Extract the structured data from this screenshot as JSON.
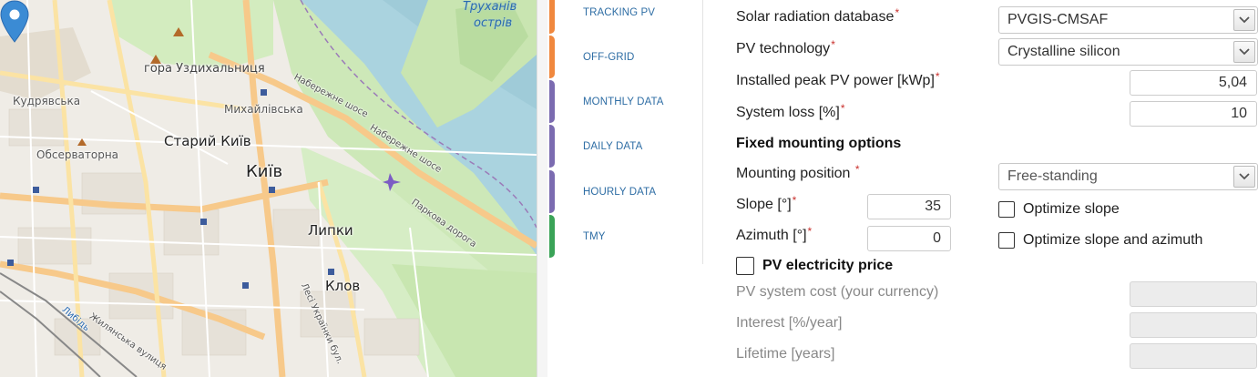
{
  "map": {
    "labels": {
      "trukhaniv": "Труханів",
      "ostriv": "острів",
      "hora": "гора Уздихальниця",
      "kudriavska": "Кудрявська",
      "mykhailivska": "Михайлівська",
      "staryi_kyiv": "Старий Київ",
      "observatorna": "Обсерваторна",
      "kyiv": "Київ",
      "lypky": "Липки",
      "klov": "Клов",
      "naberezhne1": "Набережне шосе",
      "naberezhne2": "Набережне шосе",
      "parkova": "Паркова дорога",
      "lybid": "Либідь",
      "zhylianska": "Жилянська вулиця",
      "lesi": "Лесі Українки бул."
    }
  },
  "tabs": [
    {
      "label": "TRACKING PV",
      "color": "#f0883e"
    },
    {
      "label": "OFF-GRID",
      "color": "#f0883e"
    },
    {
      "label": "MONTHLY DATA",
      "color": "#7b6bb0"
    },
    {
      "label": "DAILY DATA",
      "color": "#7b6bb0"
    },
    {
      "label": "HOURLY DATA",
      "color": "#7b6bb0"
    },
    {
      "label": "TMY",
      "color": "#3aa357"
    }
  ],
  "form": {
    "radiation_db": {
      "label": "Solar radiation database",
      "value": "PVGIS-CMSAF"
    },
    "pv_tech": {
      "label": "PV technology",
      "value": "Crystalline silicon"
    },
    "peak_power": {
      "label": "Installed peak PV power [kWp]",
      "value": "5,04"
    },
    "system_loss": {
      "label": "System loss [%]",
      "value": "10"
    },
    "fixed_title": "Fixed mounting options",
    "mounting": {
      "label": "Mounting position",
      "value": "Free-standing"
    },
    "slope": {
      "label": "Slope [°]",
      "value": "35"
    },
    "azimuth": {
      "label": "Azimuth [°]",
      "value": "0"
    },
    "optimize_slope": "Optimize slope",
    "optimize_both": "Optimize slope and azimuth",
    "pv_price": "PV electricity price",
    "system_cost": "PV system cost (your currency)",
    "interest": "Interest [%/year]",
    "lifetime": "Lifetime [years]",
    "required_mark": "*"
  }
}
